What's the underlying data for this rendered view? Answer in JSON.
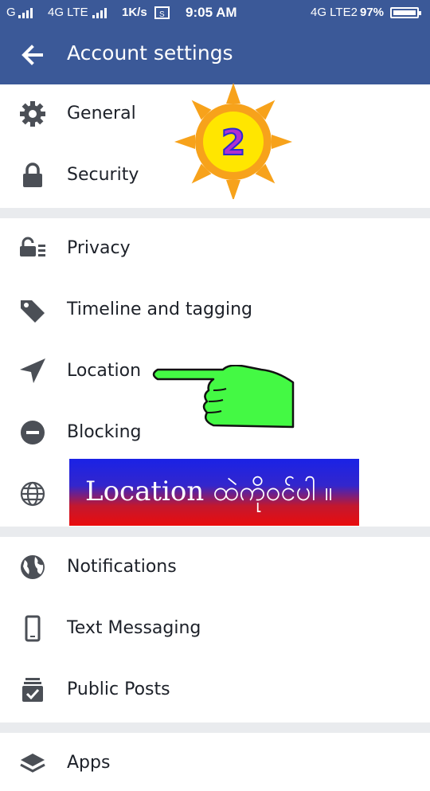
{
  "status_bar": {
    "carrier1": "G",
    "network1": "4G LTE",
    "speed": "1K/s",
    "time": "9:05 AM",
    "network2": "4G LTE2",
    "battery": "97%"
  },
  "app_bar": {
    "title": "Account settings",
    "back_icon": "arrow-left-icon"
  },
  "settings": {
    "items": [
      {
        "label": "General",
        "icon": "gear-icon"
      },
      {
        "label": "Security",
        "icon": "lock-icon"
      },
      {
        "label": "Privacy",
        "icon": "privacy-lock-icon"
      },
      {
        "label": "Timeline and tagging",
        "icon": "tag-icon"
      },
      {
        "label": "Location",
        "icon": "location-arrow-icon"
      },
      {
        "label": "Blocking",
        "icon": "blocking-icon"
      },
      {
        "label": "",
        "icon": "globe-icon"
      },
      {
        "label": "Notifications",
        "icon": "earth-icon"
      },
      {
        "label": "Text Messaging",
        "icon": "phone-icon"
      },
      {
        "label": "Public Posts",
        "icon": "public-posts-icon"
      },
      {
        "label": "Apps",
        "icon": "apps-icon"
      }
    ]
  },
  "overlay": {
    "step_number": "2",
    "banner_text": "Location ထဲကိုဝင်ပါ ။"
  },
  "colors": {
    "brand": "#3b5998",
    "separator": "#e9ebee",
    "text": "#1d2129",
    "icon": "#4b4f56",
    "sun": "#f7a21b",
    "sun_core": "#ffe600",
    "hand": "#44f944",
    "banner_top": "#1a22e6",
    "banner_bottom": "#ea0c0c"
  }
}
